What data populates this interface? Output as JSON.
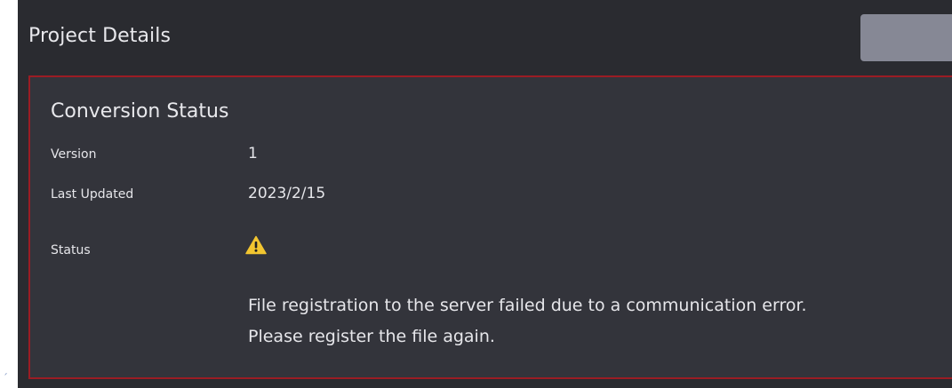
{
  "page": {
    "stray_mark": "´"
  },
  "header": {
    "title": "Project Details",
    "button_label": ""
  },
  "conversion_status": {
    "title": "Conversion Status",
    "version_label": "Version",
    "version_value": "1",
    "last_updated_label": "Last Updated",
    "last_updated_value": "2023/2/15",
    "status_label": "Status",
    "status_icon": "warning-triangle-icon",
    "message_line1": "File registration to the server failed due to a communication error.",
    "message_line2": "Please register the file again."
  },
  "colors": {
    "panel_bg": "#2a2b30",
    "card_bg": "#33343b",
    "card_border": "#9b1c24",
    "header_button": "#868895",
    "warning": "#f2c530",
    "text": "#e6e6ea"
  }
}
